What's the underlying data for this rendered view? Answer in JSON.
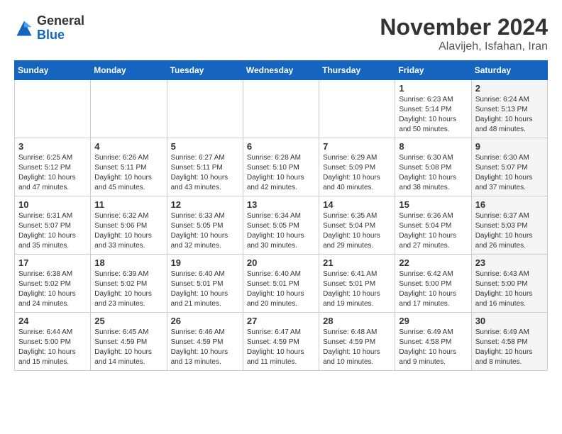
{
  "header": {
    "logo": {
      "general": "General",
      "blue": "Blue"
    },
    "title": "November 2024",
    "location": "Alavijeh, Isfahan, Iran"
  },
  "weekdays": [
    "Sunday",
    "Monday",
    "Tuesday",
    "Wednesday",
    "Thursday",
    "Friday",
    "Saturday"
  ],
  "weeks": [
    [
      {
        "day": "",
        "text": "",
        "shaded": false
      },
      {
        "day": "",
        "text": "",
        "shaded": false
      },
      {
        "day": "",
        "text": "",
        "shaded": false
      },
      {
        "day": "",
        "text": "",
        "shaded": false
      },
      {
        "day": "",
        "text": "",
        "shaded": false
      },
      {
        "day": "1",
        "text": "Sunrise: 6:23 AM\nSunset: 5:14 PM\nDaylight: 10 hours\nand 50 minutes.",
        "shaded": false
      },
      {
        "day": "2",
        "text": "Sunrise: 6:24 AM\nSunset: 5:13 PM\nDaylight: 10 hours\nand 48 minutes.",
        "shaded": true
      }
    ],
    [
      {
        "day": "3",
        "text": "Sunrise: 6:25 AM\nSunset: 5:12 PM\nDaylight: 10 hours\nand 47 minutes.",
        "shaded": false
      },
      {
        "day": "4",
        "text": "Sunrise: 6:26 AM\nSunset: 5:11 PM\nDaylight: 10 hours\nand 45 minutes.",
        "shaded": false
      },
      {
        "day": "5",
        "text": "Sunrise: 6:27 AM\nSunset: 5:11 PM\nDaylight: 10 hours\nand 43 minutes.",
        "shaded": false
      },
      {
        "day": "6",
        "text": "Sunrise: 6:28 AM\nSunset: 5:10 PM\nDaylight: 10 hours\nand 42 minutes.",
        "shaded": false
      },
      {
        "day": "7",
        "text": "Sunrise: 6:29 AM\nSunset: 5:09 PM\nDaylight: 10 hours\nand 40 minutes.",
        "shaded": false
      },
      {
        "day": "8",
        "text": "Sunrise: 6:30 AM\nSunset: 5:08 PM\nDaylight: 10 hours\nand 38 minutes.",
        "shaded": false
      },
      {
        "day": "9",
        "text": "Sunrise: 6:30 AM\nSunset: 5:07 PM\nDaylight: 10 hours\nand 37 minutes.",
        "shaded": true
      }
    ],
    [
      {
        "day": "10",
        "text": "Sunrise: 6:31 AM\nSunset: 5:07 PM\nDaylight: 10 hours\nand 35 minutes.",
        "shaded": false
      },
      {
        "day": "11",
        "text": "Sunrise: 6:32 AM\nSunset: 5:06 PM\nDaylight: 10 hours\nand 33 minutes.",
        "shaded": false
      },
      {
        "day": "12",
        "text": "Sunrise: 6:33 AM\nSunset: 5:05 PM\nDaylight: 10 hours\nand 32 minutes.",
        "shaded": false
      },
      {
        "day": "13",
        "text": "Sunrise: 6:34 AM\nSunset: 5:05 PM\nDaylight: 10 hours\nand 30 minutes.",
        "shaded": false
      },
      {
        "day": "14",
        "text": "Sunrise: 6:35 AM\nSunset: 5:04 PM\nDaylight: 10 hours\nand 29 minutes.",
        "shaded": false
      },
      {
        "day": "15",
        "text": "Sunrise: 6:36 AM\nSunset: 5:04 PM\nDaylight: 10 hours\nand 27 minutes.",
        "shaded": false
      },
      {
        "day": "16",
        "text": "Sunrise: 6:37 AM\nSunset: 5:03 PM\nDaylight: 10 hours\nand 26 minutes.",
        "shaded": true
      }
    ],
    [
      {
        "day": "17",
        "text": "Sunrise: 6:38 AM\nSunset: 5:02 PM\nDaylight: 10 hours\nand 24 minutes.",
        "shaded": false
      },
      {
        "day": "18",
        "text": "Sunrise: 6:39 AM\nSunset: 5:02 PM\nDaylight: 10 hours\nand 23 minutes.",
        "shaded": false
      },
      {
        "day": "19",
        "text": "Sunrise: 6:40 AM\nSunset: 5:01 PM\nDaylight: 10 hours\nand 21 minutes.",
        "shaded": false
      },
      {
        "day": "20",
        "text": "Sunrise: 6:40 AM\nSunset: 5:01 PM\nDaylight: 10 hours\nand 20 minutes.",
        "shaded": false
      },
      {
        "day": "21",
        "text": "Sunrise: 6:41 AM\nSunset: 5:01 PM\nDaylight: 10 hours\nand 19 minutes.",
        "shaded": false
      },
      {
        "day": "22",
        "text": "Sunrise: 6:42 AM\nSunset: 5:00 PM\nDaylight: 10 hours\nand 17 minutes.",
        "shaded": false
      },
      {
        "day": "23",
        "text": "Sunrise: 6:43 AM\nSunset: 5:00 PM\nDaylight: 10 hours\nand 16 minutes.",
        "shaded": true
      }
    ],
    [
      {
        "day": "24",
        "text": "Sunrise: 6:44 AM\nSunset: 5:00 PM\nDaylight: 10 hours\nand 15 minutes.",
        "shaded": false
      },
      {
        "day": "25",
        "text": "Sunrise: 6:45 AM\nSunset: 4:59 PM\nDaylight: 10 hours\nand 14 minutes.",
        "shaded": false
      },
      {
        "day": "26",
        "text": "Sunrise: 6:46 AM\nSunset: 4:59 PM\nDaylight: 10 hours\nand 13 minutes.",
        "shaded": false
      },
      {
        "day": "27",
        "text": "Sunrise: 6:47 AM\nSunset: 4:59 PM\nDaylight: 10 hours\nand 11 minutes.",
        "shaded": false
      },
      {
        "day": "28",
        "text": "Sunrise: 6:48 AM\nSunset: 4:59 PM\nDaylight: 10 hours\nand 10 minutes.",
        "shaded": false
      },
      {
        "day": "29",
        "text": "Sunrise: 6:49 AM\nSunset: 4:58 PM\nDaylight: 10 hours\nand 9 minutes.",
        "shaded": false
      },
      {
        "day": "30",
        "text": "Sunrise: 6:49 AM\nSunset: 4:58 PM\nDaylight: 10 hours\nand 8 minutes.",
        "shaded": true
      }
    ]
  ]
}
